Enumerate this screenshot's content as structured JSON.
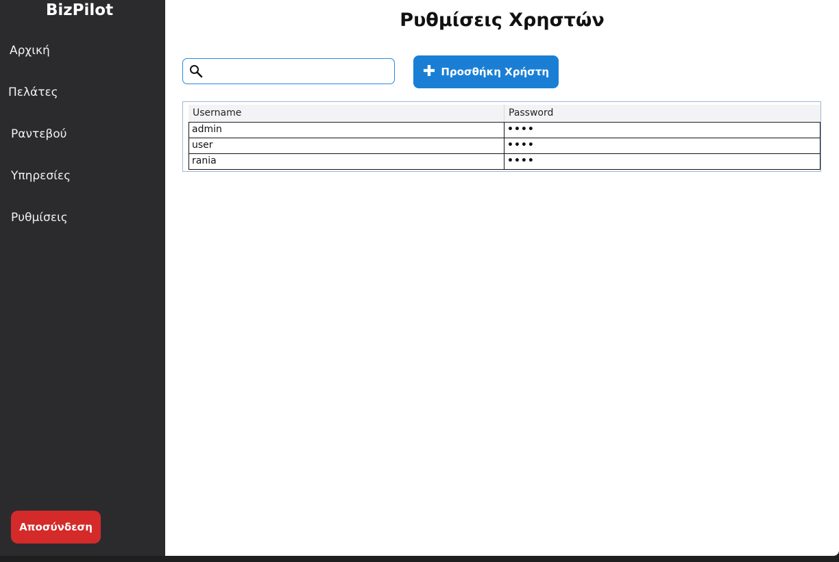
{
  "sidebar": {
    "brand": "BizPilot",
    "items": [
      {
        "label": "Αρχική"
      },
      {
        "label": "Πελάτες"
      },
      {
        "label": "Ραντεβού"
      },
      {
        "label": "Υπηρεσίες"
      },
      {
        "label": "Ρυθμίσεις"
      }
    ],
    "logout_label": "Αποσύνδεση",
    "logout_color": "#d42a2a",
    "background": "#2b2b2e"
  },
  "main": {
    "title": "Ρυθμίσεις Χρηστών",
    "search": {
      "value": "",
      "placeholder": "",
      "icon": "search-icon"
    },
    "add_button": {
      "icon": "plus-icon",
      "label": "Προσθήκη Χρήστη",
      "color": "#1a7fd4"
    },
    "table": {
      "columns": [
        "Username",
        "Password"
      ],
      "rows": [
        {
          "username": "admin",
          "password": "••••"
        },
        {
          "username": "user",
          "password": "••••"
        },
        {
          "username": "rania",
          "password": "••••"
        }
      ]
    }
  }
}
